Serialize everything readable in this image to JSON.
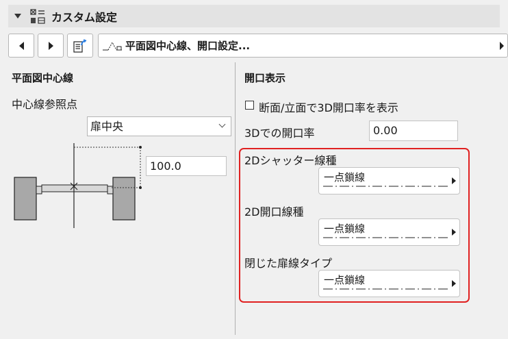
{
  "header": {
    "title": "カスタム設定",
    "collapse_icon": "triangle-down-icon",
    "panel_icon": "custom-settings-icon"
  },
  "nav": {
    "prev_icon": "arrow-left-icon",
    "next_icon": "arrow-right-icon",
    "doc_icon": "document-export-icon",
    "selector_label": "平面図中心線、開口設定...",
    "selector_icon": "door-opening-icon",
    "selector_arrow_icon": "arrow-right-icon"
  },
  "left": {
    "section_title": "平面図中心線",
    "ref_point_label": "中心線参照点",
    "ref_point_value": "扉中央",
    "offset_value": "100.0"
  },
  "right": {
    "section_title": "開口表示",
    "checkbox_label": "断面/立面で3D開口率を表示",
    "checkbox_checked": false,
    "opening_ratio_label": "3Dでの開口率",
    "opening_ratio_value": "0.00",
    "line_settings": [
      {
        "label": "2Dシャッター線種",
        "value": "一点鎖線"
      },
      {
        "label": "2D開口線種",
        "value": "一点鎖線"
      },
      {
        "label": "閉じた扉線タイプ",
        "value": "一点鎖線"
      }
    ]
  },
  "colors": {
    "highlight": "#e02020",
    "panel_bg": "#f0f0f0",
    "header_bg": "#e3e3e3"
  }
}
